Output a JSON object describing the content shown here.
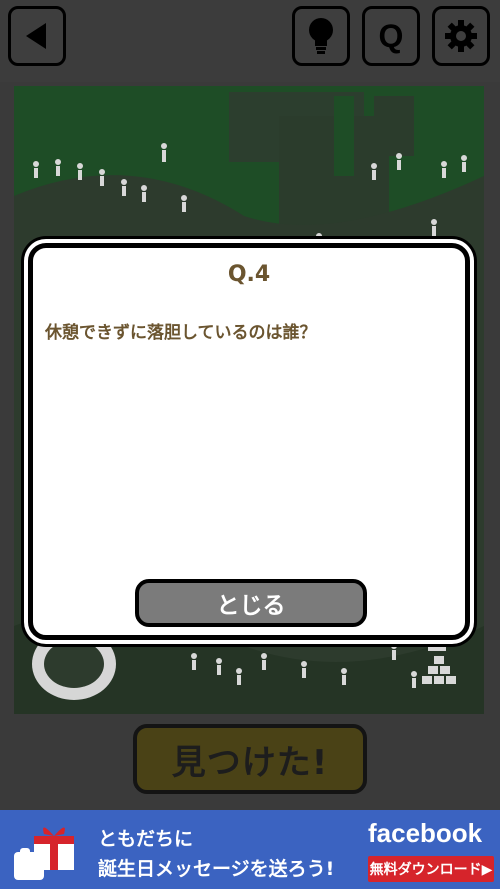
{
  "header": {
    "back_icon": "back-triangle-icon",
    "hint_icon": "lightbulb-icon",
    "question_icon_label": "Q",
    "settings_icon": "gear-icon"
  },
  "modal": {
    "title": "Q.4",
    "question": "休憩できずに落胆しているのは誰？",
    "close_label": "とじる"
  },
  "footer": {
    "found_label": "見つけた!"
  },
  "ad": {
    "line1": "ともだちに",
    "line2": "誕生日メッセージを送ろう!",
    "brand": "facebook",
    "cta": "無料ダウンロード▶"
  },
  "colors": {
    "scene_bg": "#1e4d26",
    "modal_text": "#6b5530",
    "close_button": "#7b7b7b",
    "ad_bg": "#3b63c1",
    "cta_red": "#d6242b"
  }
}
